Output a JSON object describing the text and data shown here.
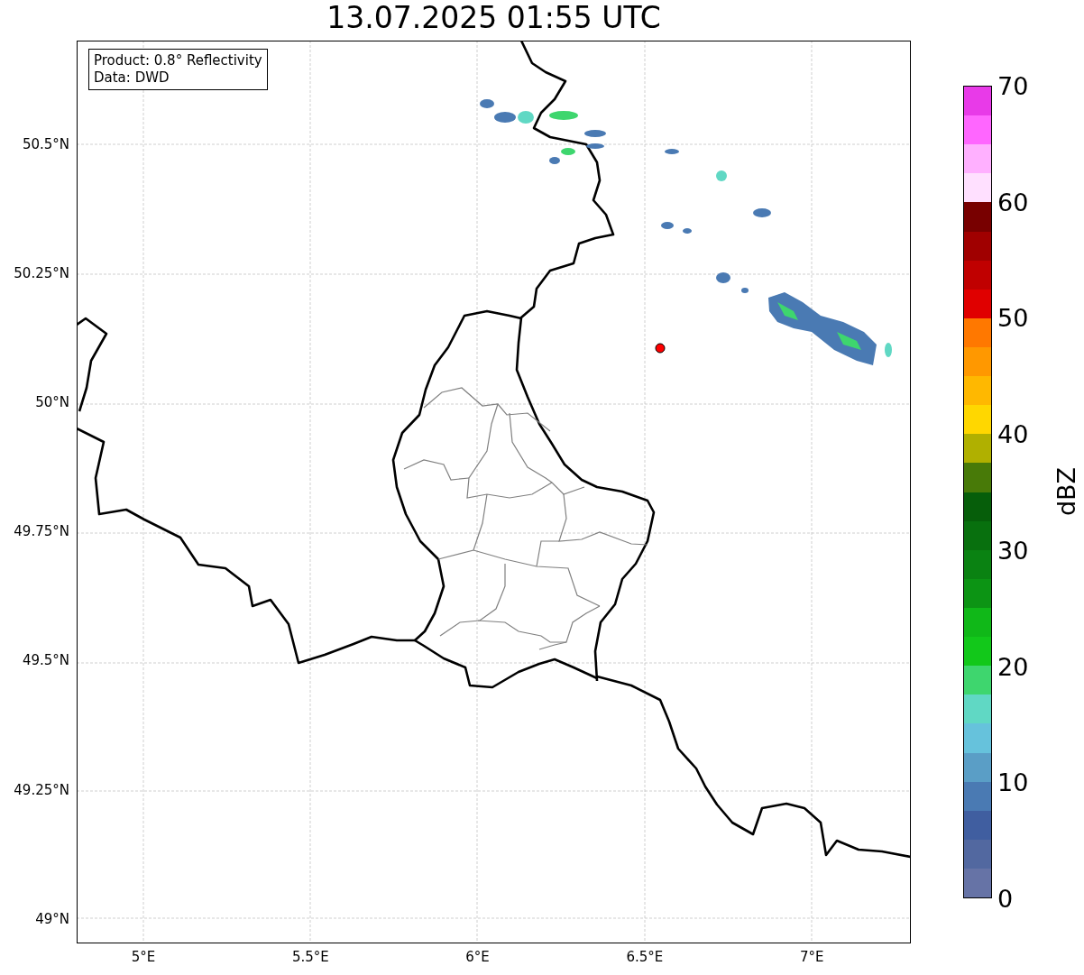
{
  "title": "13.07.2025 01:55 UTC",
  "info_box": [
    "Product: 0.8° Reflectivity",
    "Data: DWD"
  ],
  "y_ticks": [
    "50.5°N",
    "50.25°N",
    "50°N",
    "49.75°N",
    "49.5°N",
    "49.25°N",
    "49°N"
  ],
  "x_ticks": [
    "5°E",
    "5.5°E",
    "6°E",
    "6.5°E",
    "7°E"
  ],
  "colorbar": {
    "label": "dBZ",
    "ticks": [
      "70",
      "60",
      "50",
      "40",
      "30",
      "20",
      "10",
      "0"
    ],
    "bins": [
      {
        "color": "#e83ae8"
      },
      {
        "color": "#ff66ff"
      },
      {
        "color": "#ffb0ff"
      },
      {
        "color": "#ffe0ff"
      },
      {
        "color": "#780000"
      },
      {
        "color": "#a00000"
      },
      {
        "color": "#c00000"
      },
      {
        "color": "#e00000"
      },
      {
        "color": "#ff7800"
      },
      {
        "color": "#ff9800"
      },
      {
        "color": "#ffb800"
      },
      {
        "color": "#ffd700"
      },
      {
        "color": "#b0b000"
      },
      {
        "color": "#487a08"
      },
      {
        "color": "#065e0a"
      },
      {
        "color": "#08700e"
      },
      {
        "color": "#0a8212"
      },
      {
        "color": "#0c9414"
      },
      {
        "color": "#10b818"
      },
      {
        "color": "#12c81a"
      },
      {
        "color": "#3ed66e"
      },
      {
        "color": "#60d8c4"
      },
      {
        "color": "#66c2dc"
      },
      {
        "color": "#5a9ec6"
      },
      {
        "color": "#4a7ab3"
      },
      {
        "color": "#405ea0"
      },
      {
        "color": "#5268a0"
      },
      {
        "color": "#6673a6"
      }
    ]
  }
}
